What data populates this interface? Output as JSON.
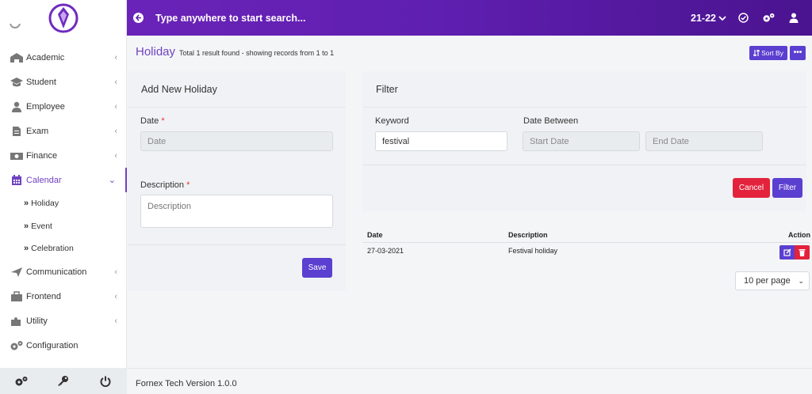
{
  "topbar": {
    "search_placeholder": "Type anywhere to start search...",
    "session": "21-22"
  },
  "sidebar": {
    "items": [
      {
        "label": "Academic",
        "icon": "school-icon"
      },
      {
        "label": "Student",
        "icon": "graduation-cap-icon"
      },
      {
        "label": "Employee",
        "icon": "user-tie-icon"
      },
      {
        "label": "Exam",
        "icon": "file-icon"
      },
      {
        "label": "Finance",
        "icon": "money-icon"
      },
      {
        "label": "Calendar",
        "icon": "calendar-icon"
      }
    ],
    "calendar_sub": [
      "Holiday",
      "Event",
      "Celebration"
    ],
    "items_after": [
      {
        "label": "Communication",
        "icon": "paper-plane-icon"
      },
      {
        "label": "Frontend",
        "icon": "briefcase-icon"
      },
      {
        "label": "Utility",
        "icon": "puzzle-icon"
      },
      {
        "label": "Configuration",
        "icon": "cogs-icon"
      }
    ]
  },
  "page": {
    "title": "Holiday",
    "subtitle": "Total 1 result found - showing records from 1 to 1",
    "sort_label": "Sort By",
    "more_label": "•••"
  },
  "add_form": {
    "heading": "Add New Holiday",
    "date_label": "Date",
    "date_placeholder": "Date",
    "description_label": "Description",
    "description_placeholder": "Description",
    "required_mark": "*",
    "save_label": "Save"
  },
  "filter": {
    "heading": "Filter",
    "keyword_label": "Keyword",
    "keyword_value": "festival",
    "date_between_label": "Date Between",
    "start_placeholder": "Start Date",
    "end_placeholder": "End Date",
    "cancel_label": "Cancel",
    "filter_label": "Filter"
  },
  "table": {
    "headers": {
      "date": "Date",
      "description": "Description",
      "action": "Action"
    },
    "rows": [
      {
        "date": "27-03-2021",
        "description": "Festival holiday"
      }
    ],
    "per_page": "10 per page"
  },
  "footer": {
    "version": "Fornex Tech Version 1.0.0"
  },
  "colors": {
    "primary": "#5a3fd0",
    "accent_text": "#6f42c1",
    "danger": "#e3233c",
    "topbar_start": "#6a23b8",
    "topbar_end": "#4a138f"
  }
}
